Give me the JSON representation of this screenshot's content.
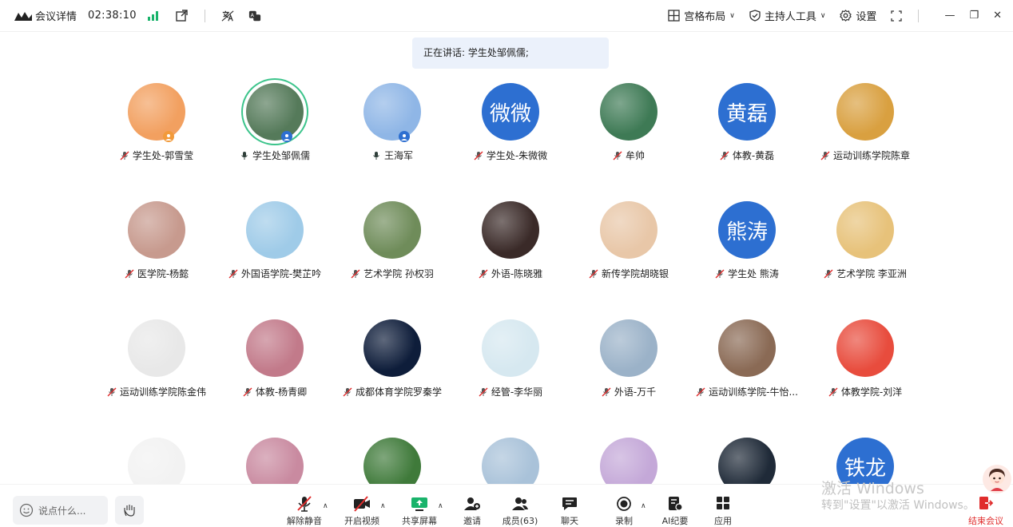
{
  "topbar": {
    "meeting_detail": "会议详情",
    "timer": "02:38:10",
    "layout_label": "宫格布局",
    "host_tools_label": "主持人工具",
    "settings_label": "设置"
  },
  "speaking_banner": "正在讲话: 学生处邹佩儒;",
  "participants": [
    {
      "name": "学生处-郭雪莹",
      "mic": "muted",
      "avatar": "photo",
      "color": "#f2a060"
    },
    {
      "name": "学生处邹佩儒",
      "mic": "on",
      "avatar": "photo",
      "color": "#557a5a"
    },
    {
      "name": "王海军",
      "mic": "on",
      "avatar": "photo",
      "color": "#8fb6e6"
    },
    {
      "name": "学生处-朱微微",
      "mic": "muted",
      "avatar": "text",
      "avatar_text": "微微"
    },
    {
      "name": "牟帅",
      "mic": "muted",
      "avatar": "photo",
      "color": "#3e7a55"
    },
    {
      "name": "体教-黄磊",
      "mic": "muted",
      "avatar": "text",
      "avatar_text": "黄磊"
    },
    {
      "name": "运动训练学院陈章",
      "mic": "muted",
      "avatar": "photo",
      "color": "#d9a040"
    },
    {
      "name": "医学院-杨懿",
      "mic": "muted",
      "avatar": "photo",
      "color": "#c79a8e"
    },
    {
      "name": "外国语学院-樊芷吟",
      "mic": "muted",
      "avatar": "photo",
      "color": "#9fcbe8"
    },
    {
      "name": "艺术学院 孙权羽",
      "mic": "muted",
      "avatar": "photo",
      "color": "#6f8c5a"
    },
    {
      "name": "外语-陈晓雅",
      "mic": "muted",
      "avatar": "photo",
      "color": "#3a2a28"
    },
    {
      "name": "新传学院胡晓银",
      "mic": "muted",
      "avatar": "photo",
      "color": "#e8c7a8"
    },
    {
      "name": "学生处 熊涛",
      "mic": "muted",
      "avatar": "text",
      "avatar_text": "熊涛"
    },
    {
      "name": "艺术学院  李亚洲",
      "mic": "muted",
      "avatar": "photo",
      "color": "#e7c27a"
    },
    {
      "name": "运动训练学院陈金伟",
      "mic": "muted",
      "avatar": "photo",
      "color": "#e8e8e8"
    },
    {
      "name": "体教-杨青卿",
      "mic": "muted",
      "avatar": "photo",
      "color": "#c27a8a"
    },
    {
      "name": "成都体育学院罗秦学",
      "mic": "muted",
      "avatar": "photo",
      "color": "#0e1d3a"
    },
    {
      "name": "经管-李华丽",
      "mic": "muted",
      "avatar": "photo",
      "color": "#d6e8f0"
    },
    {
      "name": "外语-万千",
      "mic": "muted",
      "avatar": "photo",
      "color": "#9bb2c8"
    },
    {
      "name": "运动训练学院-牛怡...",
      "mic": "muted",
      "avatar": "photo",
      "color": "#8a6a55"
    },
    {
      "name": "体教学院-刘洋",
      "mic": "muted",
      "avatar": "photo",
      "color": "#e84c3d"
    },
    {
      "name": "",
      "mic": "none",
      "avatar": "photo",
      "color": "#f2f2f2"
    },
    {
      "name": "",
      "mic": "none",
      "avatar": "photo",
      "color": "#c98aa0"
    },
    {
      "name": "",
      "mic": "none",
      "avatar": "photo",
      "color": "#3f7a3a"
    },
    {
      "name": "",
      "mic": "none",
      "avatar": "photo",
      "color": "#a9c2d9"
    },
    {
      "name": "",
      "mic": "none",
      "avatar": "photo",
      "color": "#c4a8d8"
    },
    {
      "name": "",
      "mic": "none",
      "avatar": "photo",
      "color": "#1f2a38"
    },
    {
      "name": "",
      "mic": "none",
      "avatar": "text",
      "avatar_text": "铁龙"
    }
  ],
  "bottombar": {
    "chat_placeholder": "说点什么...",
    "tools": [
      {
        "label": "解除静音",
        "icon": "mic-muted-icon"
      },
      {
        "label": "开启视频",
        "icon": "camera-off-icon"
      },
      {
        "label": "共享屏幕",
        "icon": "share-screen-icon"
      },
      {
        "label": "邀请",
        "icon": "invite-icon"
      },
      {
        "label": "成员(63)",
        "icon": "members-icon"
      },
      {
        "label": "聊天",
        "icon": "chat-icon"
      },
      {
        "label": "录制",
        "icon": "record-icon"
      },
      {
        "label": "AI纪要",
        "icon": "ai-notes-icon"
      },
      {
        "label": "应用",
        "icon": "apps-icon"
      }
    ],
    "end_label": "结束会议"
  },
  "watermark": {
    "line1": "激活 Windows",
    "line2": "转到\"设置\"以激活 Windows。"
  },
  "colors": {
    "accent_blue": "#2d6fd1",
    "signal_green": "#1ab36b",
    "active_ring": "#3cc48b",
    "mute_red": "#e02c2c"
  }
}
